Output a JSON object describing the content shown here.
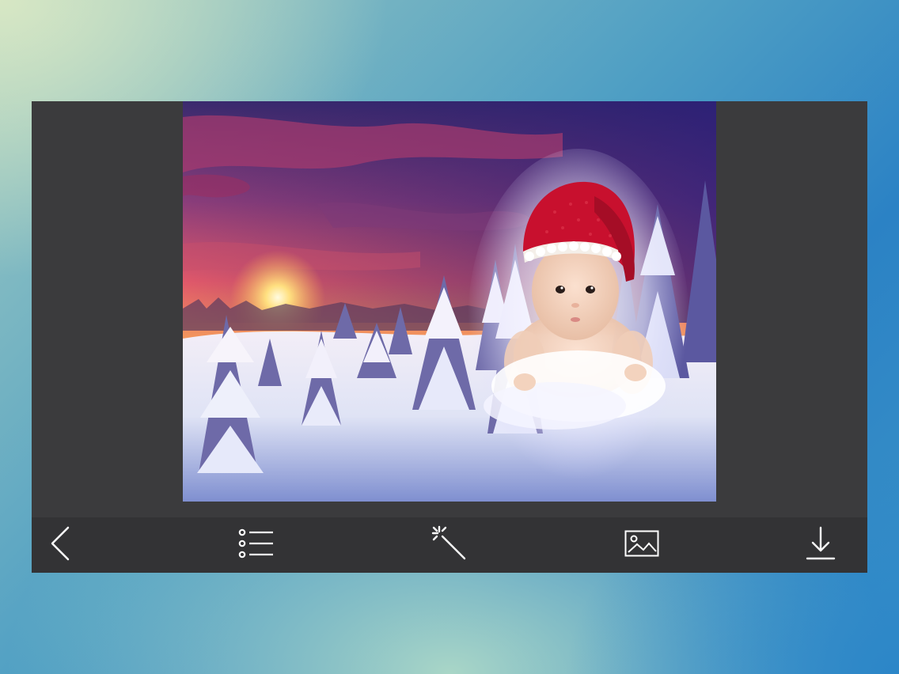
{
  "toolbar": {
    "items": [
      {
        "icon": "back-icon"
      },
      {
        "icon": "list-icon"
      },
      {
        "icon": "magic-wand-icon"
      },
      {
        "icon": "image-icon"
      },
      {
        "icon": "download-icon"
      }
    ]
  },
  "colors": {
    "panel": "#3b3b3d",
    "toolbar": "#333335",
    "icon": "#ffffff",
    "hat": "#c8102e"
  }
}
